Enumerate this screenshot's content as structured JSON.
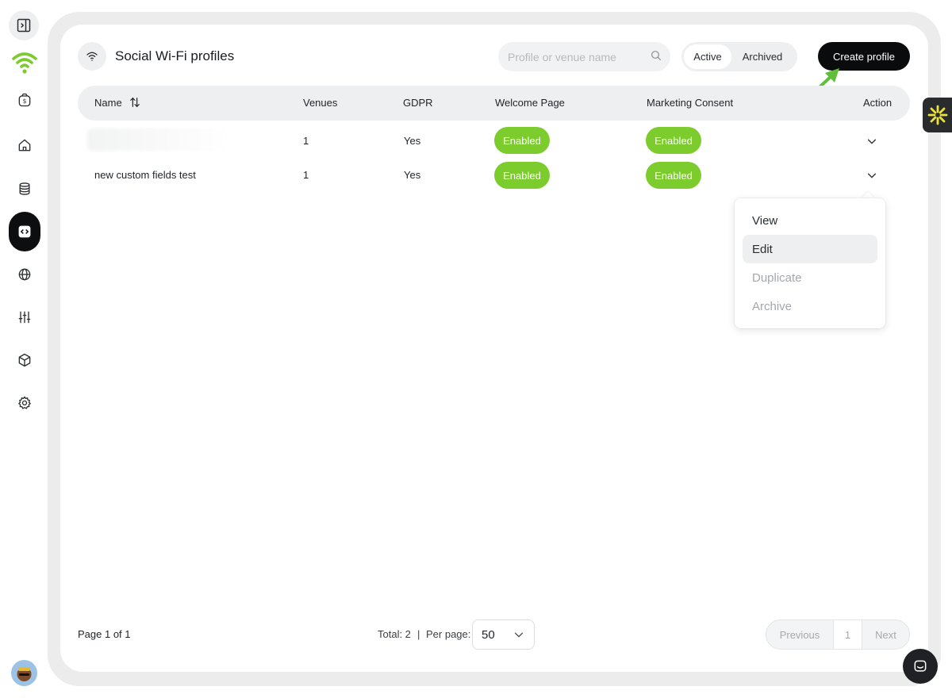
{
  "app": {
    "page_title": "Social Wi-Fi profiles"
  },
  "search": {
    "placeholder": "Profile or venue name",
    "value": ""
  },
  "filter_tabs": {
    "active_label": "Active",
    "archived_label": "Archived",
    "selected": "Active"
  },
  "toolbar": {
    "create_label": "Create profile"
  },
  "table": {
    "columns": {
      "name": "Name",
      "venues": "Venues",
      "gdpr": "GDPR",
      "welcome_page": "Welcome Page",
      "marketing_consent": "Marketing Consent",
      "action": "Action"
    },
    "rows": [
      {
        "name": "",
        "venues": "1",
        "gdpr": "Yes",
        "welcome_page": "Enabled",
        "marketing_consent": "Enabled"
      },
      {
        "name": "new custom fields test",
        "venues": "1",
        "gdpr": "Yes",
        "welcome_page": "Enabled",
        "marketing_consent": "Enabled"
      }
    ]
  },
  "action_menu": {
    "items": [
      {
        "label": "View",
        "state": "normal"
      },
      {
        "label": "Edit",
        "state": "hover"
      },
      {
        "label": "Duplicate",
        "state": "disabled"
      },
      {
        "label": "Archive",
        "state": "disabled"
      }
    ]
  },
  "footer": {
    "page_info": "Page 1 of 1",
    "total": "Total: 2",
    "separator": "|",
    "per_page_label": "Per page:",
    "per_page_value": "50",
    "prev_label": "Previous",
    "current_page": "1",
    "next_label": "Next"
  },
  "colors": {
    "accent_green": "#7bcc2c",
    "primary_black": "#0a0b0c",
    "frame_grey": "#ececec"
  },
  "icons": {
    "sidebar": [
      "panel-toggle-icon",
      "wifi-logo-icon",
      "billing-icon",
      "home-icon",
      "database-icon",
      "code-icon",
      "globe-icon",
      "sliders-icon",
      "cube-icon",
      "gear-icon"
    ]
  }
}
